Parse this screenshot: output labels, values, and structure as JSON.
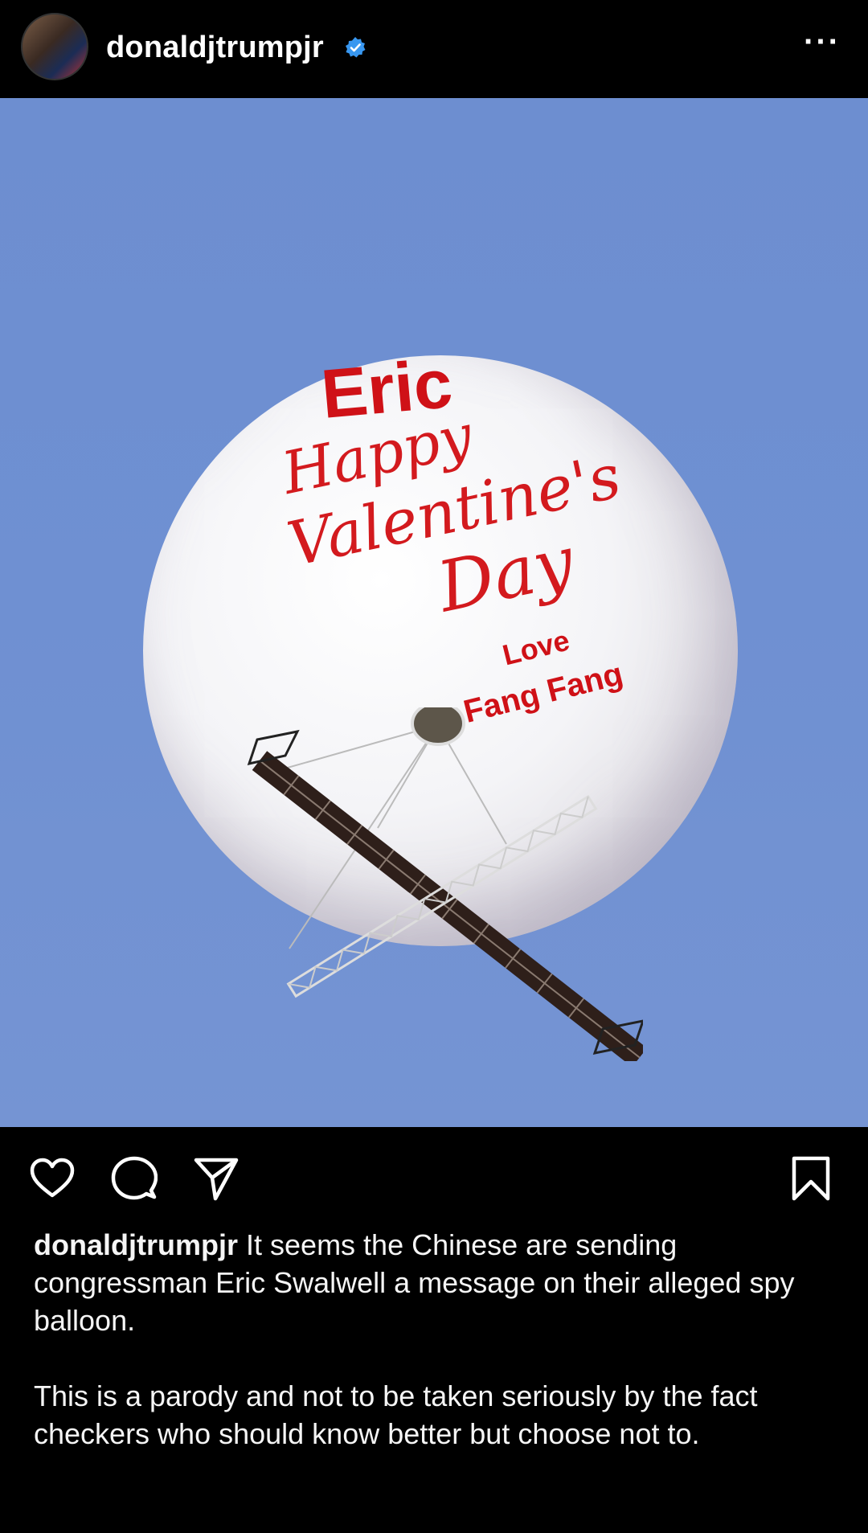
{
  "post": {
    "username": "donaldjtrumpjr",
    "verified": true,
    "more_icon": "more-horizontal-icon",
    "image": {
      "lines": {
        "name": "Eric",
        "greeting_1": "Happy",
        "greeting_2": "Valentine's",
        "greeting_3": "Day",
        "love": "Love",
        "signed": "Fang Fang"
      },
      "sky_color": "#6f90d2",
      "text_color": "#d31a1e"
    },
    "actions": {
      "like_icon": "heart-icon",
      "comment_icon": "comment-icon",
      "share_icon": "send-icon",
      "save_icon": "bookmark-icon"
    },
    "caption": {
      "username": "donaldjtrumpjr",
      "text": "It seems the Chinese are sending congressman Eric Swalwell a message on their alleged spy balloon.",
      "text_2": "This is a parody and not to be taken seriously by the fact checkers who should know better but choose not to."
    }
  },
  "colors": {
    "background": "#000000",
    "verified_badge": "#3897f0"
  }
}
